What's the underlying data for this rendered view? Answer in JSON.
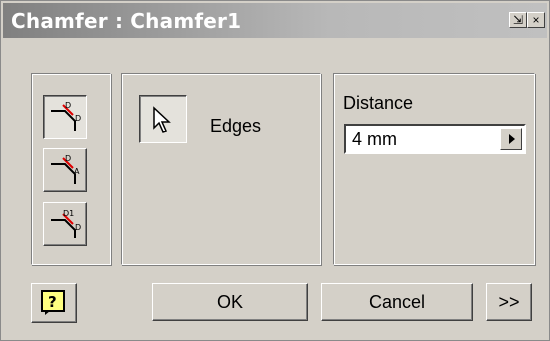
{
  "window": {
    "title": "Chamfer : Chamfer1"
  },
  "titlebar_buttons": {
    "pin_label": "⇲",
    "close_label": "×"
  },
  "method_buttons": [
    {
      "icon": "chamfer-distance-icon"
    },
    {
      "icon": "chamfer-distance-angle-icon"
    },
    {
      "icon": "chamfer-two-distances-icon"
    }
  ],
  "selection": {
    "edges_label": "Edges",
    "icon": "select-arrow-icon"
  },
  "distance": {
    "label": "Distance",
    "value": "4 mm"
  },
  "buttons": {
    "help_icon": "help-icon",
    "help_label": "?",
    "ok": "OK",
    "cancel": "Cancel",
    "more": ">>"
  },
  "colors": {
    "icon_red": "#e00000",
    "title_gradient_start": "#808080",
    "face": "#d4d0c8"
  }
}
